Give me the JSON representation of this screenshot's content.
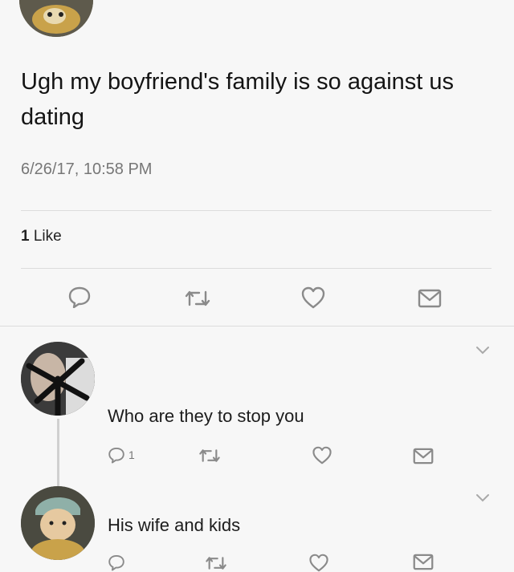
{
  "main_tweet": {
    "text": "Ugh my boyfriend's family is so against us dating",
    "timestamp": "6/26/17, 10:58 PM",
    "like_count": "1",
    "like_label": "Like"
  },
  "replies": [
    {
      "text": "Who are they to stop you",
      "reply_count": "1"
    },
    {
      "text": "His wife and kids"
    }
  ],
  "icons": {
    "reply": "reply-icon",
    "retweet": "retweet-icon",
    "like": "heart-icon",
    "message": "envelope-icon",
    "more": "chevron-down-icon"
  },
  "colors": {
    "background": "#f7f7f7",
    "text": "#1c1c1c",
    "secondary": "#777777",
    "divider": "#dcdcdc"
  }
}
